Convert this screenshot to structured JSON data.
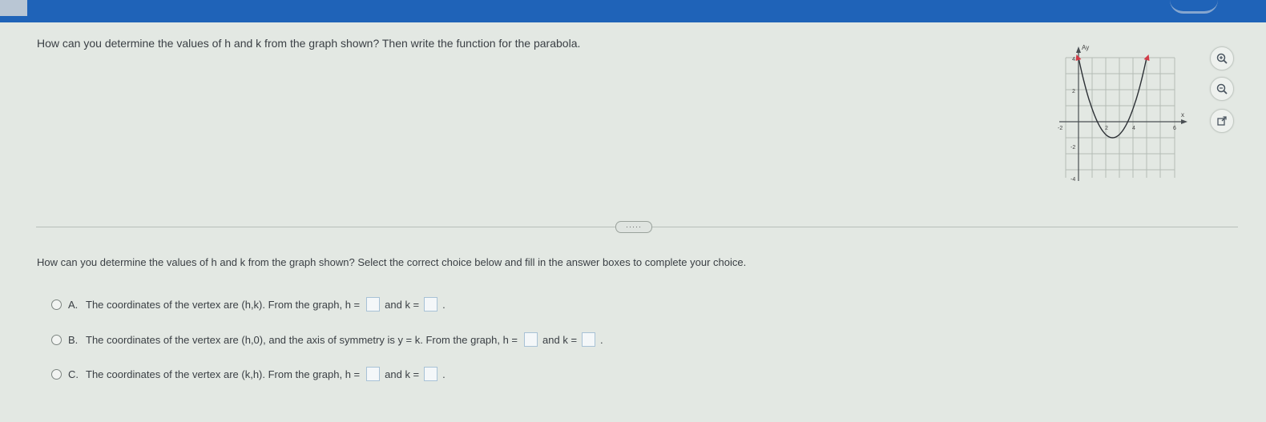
{
  "question": "How can you determine the values of h and k from the graph shown? Then write the function for the parabola.",
  "prompt": "How can you determine the values of h and k from the graph shown? Select the correct choice below and fill in the answer boxes to complete your choice.",
  "more_label": "·····",
  "graph": {
    "y_axis_label": "Ay",
    "x_axis_label": "x",
    "ticks": {
      "y_top": "4",
      "y_2": "2",
      "x_neg2": "-2",
      "x_2": "2",
      "x_4": "4",
      "x_6": "6",
      "y_neg2": "-2",
      "y_neg4": "-4"
    },
    "xlim": [
      -2,
      8
    ],
    "ylim": [
      -4,
      5
    ],
    "parabola": {
      "vertex": [
        5,
        -2
      ],
      "a": 0.4
    }
  },
  "tools": [
    "zoom-in-icon",
    "zoom-out-icon",
    "popout-icon"
  ],
  "choices": [
    {
      "letter": "A.",
      "text1": "The coordinates of the vertex are (h,k). From the graph, h =",
      "mid": "and k =",
      "end": "."
    },
    {
      "letter": "B.",
      "text1": "The coordinates of the vertex are (h,0), and the axis of symmetry is y = k. From the graph, h =",
      "mid": "and k =",
      "end": "."
    },
    {
      "letter": "C.",
      "text1": "The coordinates of the vertex are (k,h). From the graph, h =",
      "mid": "and k =",
      "end": "."
    }
  ]
}
